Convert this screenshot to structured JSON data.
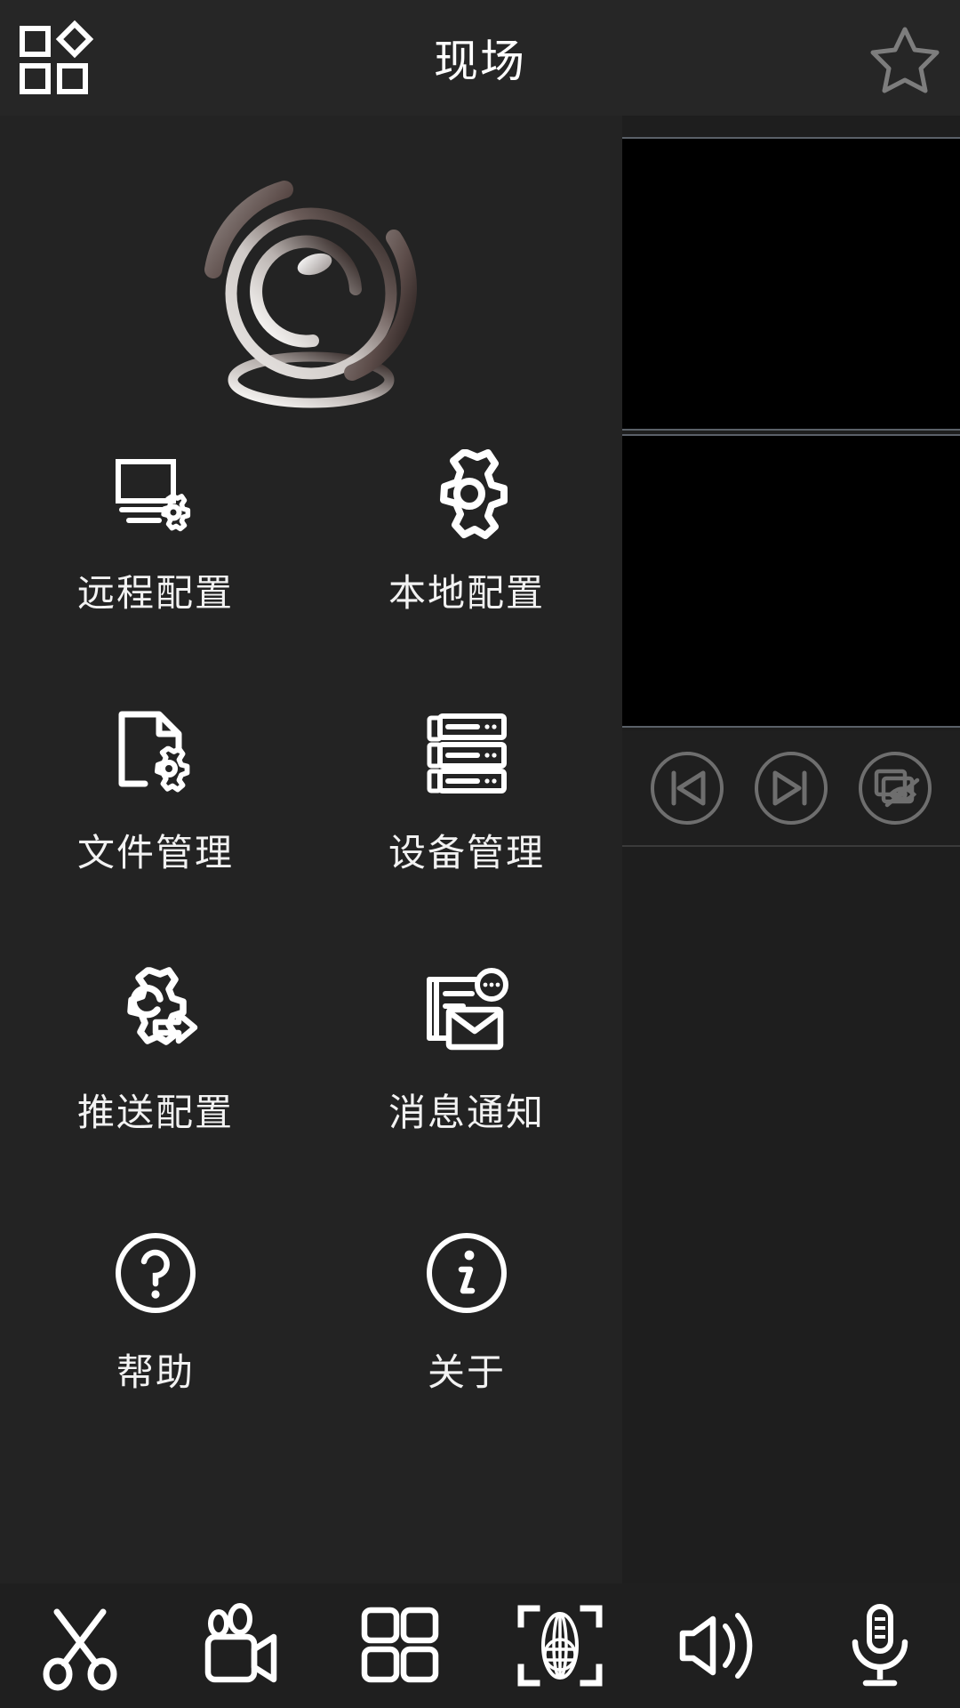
{
  "header": {
    "title": "现场",
    "menu_icon": "grid-menu-icon",
    "favorite_icon": "star-outline-icon",
    "background_color": "#262626"
  },
  "brand": {
    "logo_icon": "camera-lens-spiral-logo",
    "logo_colors": [
      "#f2f0ee",
      "#8a8280",
      "#3a2d2b",
      "#241c1b"
    ]
  },
  "menu": {
    "items": [
      {
        "label": "远程配置",
        "icon": "monitor-gear-icon"
      },
      {
        "label": "本地配置",
        "icon": "gear-icon"
      },
      {
        "label": "文件管理",
        "icon": "document-gear-icon"
      },
      {
        "label": "设备管理",
        "icon": "server-rack-icon"
      },
      {
        "label": "推送配置",
        "icon": "gear-arrow-icon"
      },
      {
        "label": "消息通知",
        "icon": "document-envelope-icon"
      },
      {
        "label": "帮助",
        "icon": "question-circle-icon"
      },
      {
        "label": "关于",
        "icon": "info-circle-icon"
      }
    ]
  },
  "video": {
    "cells": [
      {
        "name": "video-cell-1",
        "state": "blank"
      },
      {
        "name": "video-cell-2",
        "state": "blank"
      }
    ],
    "controls": [
      {
        "icon": "previous-track-icon"
      },
      {
        "icon": "next-track-icon"
      },
      {
        "icon": "multi-window-preview-icon"
      }
    ],
    "cell_background": "#000000",
    "border_color": "#5a6068"
  },
  "toolbar": {
    "items": [
      {
        "icon": "scissors-icon"
      },
      {
        "icon": "video-camera-icon"
      },
      {
        "icon": "four-grid-layout-icon"
      },
      {
        "icon": "scan-globe-icon"
      },
      {
        "icon": "speaker-icon"
      },
      {
        "icon": "microphone-icon"
      }
    ]
  },
  "theme": {
    "page_background": "#1f1f1f",
    "left_pane_background": "#232323",
    "right_pane_background": "#1e1e1e",
    "icon_color": "#ffffff",
    "label_color": "#f2f2f2",
    "muted_icon_color": "#6e6e6e"
  }
}
